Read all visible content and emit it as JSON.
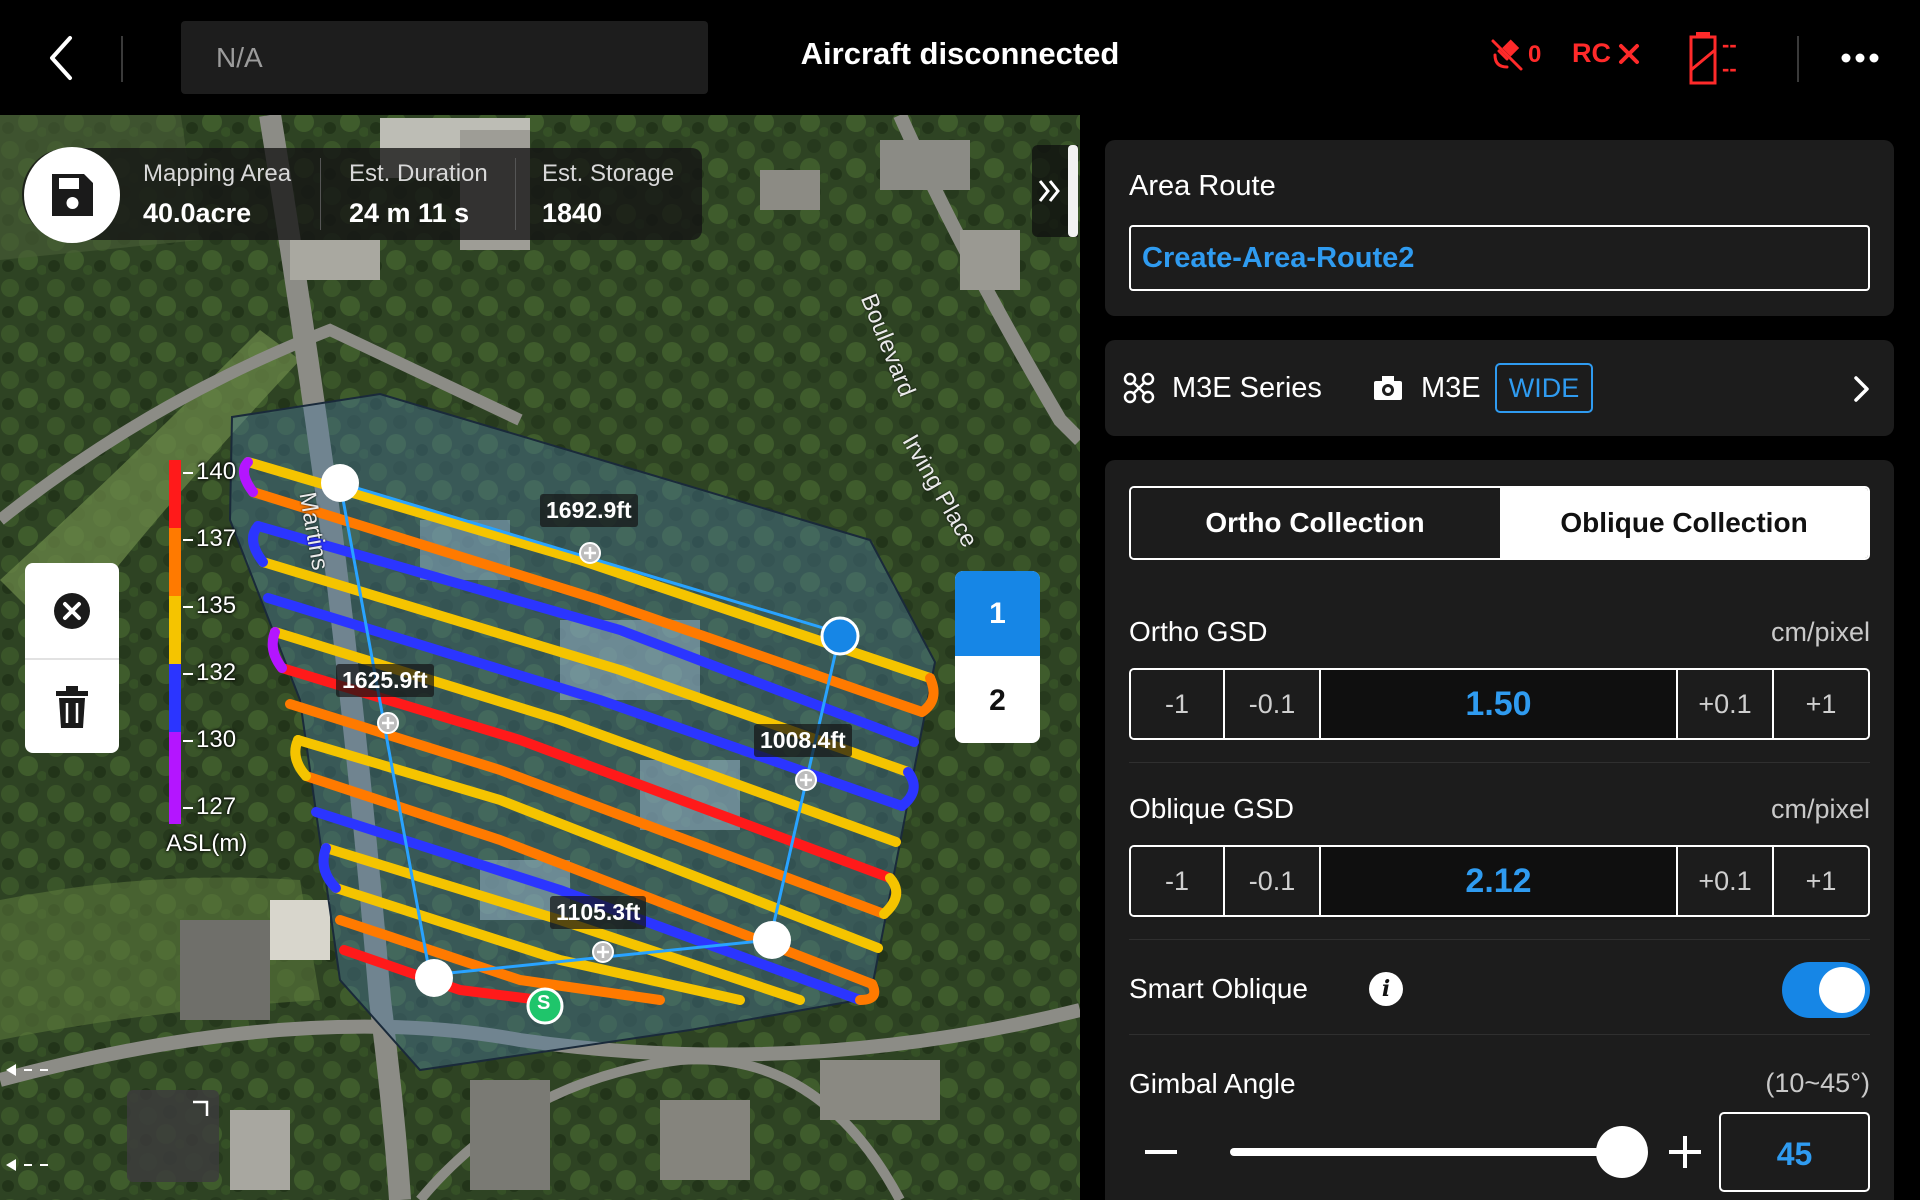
{
  "topbar": {
    "na_label": "N/A",
    "title": "Aircraft disconnected",
    "signal_count": "0",
    "rc_label": "RC",
    "battery_dashes_top": "--",
    "battery_dashes_bottom": "--"
  },
  "map": {
    "stats": [
      {
        "label": "Mapping Area",
        "value": "40.0acre"
      },
      {
        "label": "Est. Duration",
        "value": "24 m 11 s"
      },
      {
        "label": "Est. Storage",
        "value": "1840"
      }
    ],
    "legend": {
      "ticks": [
        "140",
        "137",
        "135",
        "132",
        "130",
        "127"
      ],
      "unit": "ASL(m)",
      "colors": [
        "#ff1a1a",
        "#ff7a00",
        "#f5c400",
        "#2b35ff",
        "#b415ff"
      ]
    },
    "distances": [
      "1692.9ft",
      "1625.9ft",
      "1008.4ft",
      "1105.3ft"
    ],
    "roads": [
      "Boulevard",
      "Irving Place",
      "Martins"
    ],
    "start_marker": "S",
    "route_buttons": [
      "1",
      "2"
    ]
  },
  "panel": {
    "route": {
      "title": "Area Route",
      "name": "Create-Area-Route2"
    },
    "aircraft": {
      "series": "M3E Series",
      "camera": "M3E",
      "lens": "WIDE"
    },
    "collection_tabs": {
      "ortho": "Ortho Collection",
      "oblique": "Oblique Collection",
      "active": "ortho"
    },
    "ortho_gsd": {
      "label": "Ortho GSD",
      "unit": "cm/pixel",
      "value": "1.50",
      "buttons": [
        "-1",
        "-0.1",
        "+0.1",
        "+1"
      ]
    },
    "oblique_gsd": {
      "label": "Oblique GSD",
      "unit": "cm/pixel",
      "value": "2.12",
      "buttons": [
        "-1",
        "-0.1",
        "+0.1",
        "+1"
      ]
    },
    "smart_oblique": {
      "label": "Smart Oblique",
      "enabled": true
    },
    "gimbal": {
      "label": "Gimbal Angle",
      "range": "(10~45°)",
      "value": "45"
    },
    "colors": {
      "accent": "#1686e6",
      "accent_text": "#2f9bf0",
      "alert": "#ff2a2a"
    }
  }
}
